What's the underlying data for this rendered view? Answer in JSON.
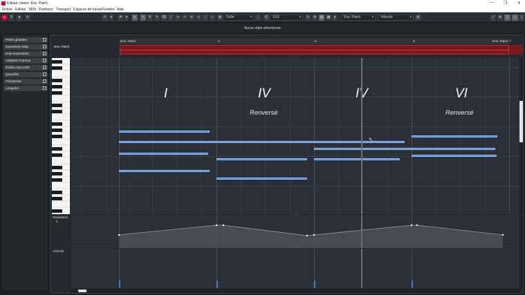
{
  "window": {
    "title": "Éditeur clavier: Ens. Patch"
  },
  "menu": {
    "items": [
      "Fichier",
      "Édition",
      "MIDI",
      "Partitions",
      "Transport",
      "Espaces de travail",
      "Fenêtre",
      "Aide"
    ]
  },
  "toolbar": {
    "snap_label": "Grille",
    "quantize_value": "1/16",
    "track_label": "Ens. Patch",
    "controller_label": "Vélocité"
  },
  "status": {
    "message": "Aucun objet sélectionné"
  },
  "inspector": {
    "items": [
      "Pistes globales",
      "Expression Map",
      "Note Expression",
      "Assistant Gamme",
      "Édition d'accords",
      "Quantifier",
      "Transposer",
      "Longueur"
    ]
  },
  "editor": {
    "track_name": "Ens. Patch",
    "ruler_labels": [
      "Ens. Patch",
      "4",
      "5",
      "6",
      "Ens. Patch",
      "7"
    ],
    "event_name": "Ens. Patch",
    "chords": [
      "I",
      "IV",
      "IV",
      "VI"
    ],
    "chord_subtitles": [
      "Renversé",
      "Renversé"
    ],
    "modulation_lane_label": "Modulation",
    "modulation_value": "1",
    "velocity_lane_label": "Vélocité"
  },
  "colors": {
    "accent": "#c8102e",
    "note": "#3d7be0",
    "event": "#7a1a1f"
  }
}
